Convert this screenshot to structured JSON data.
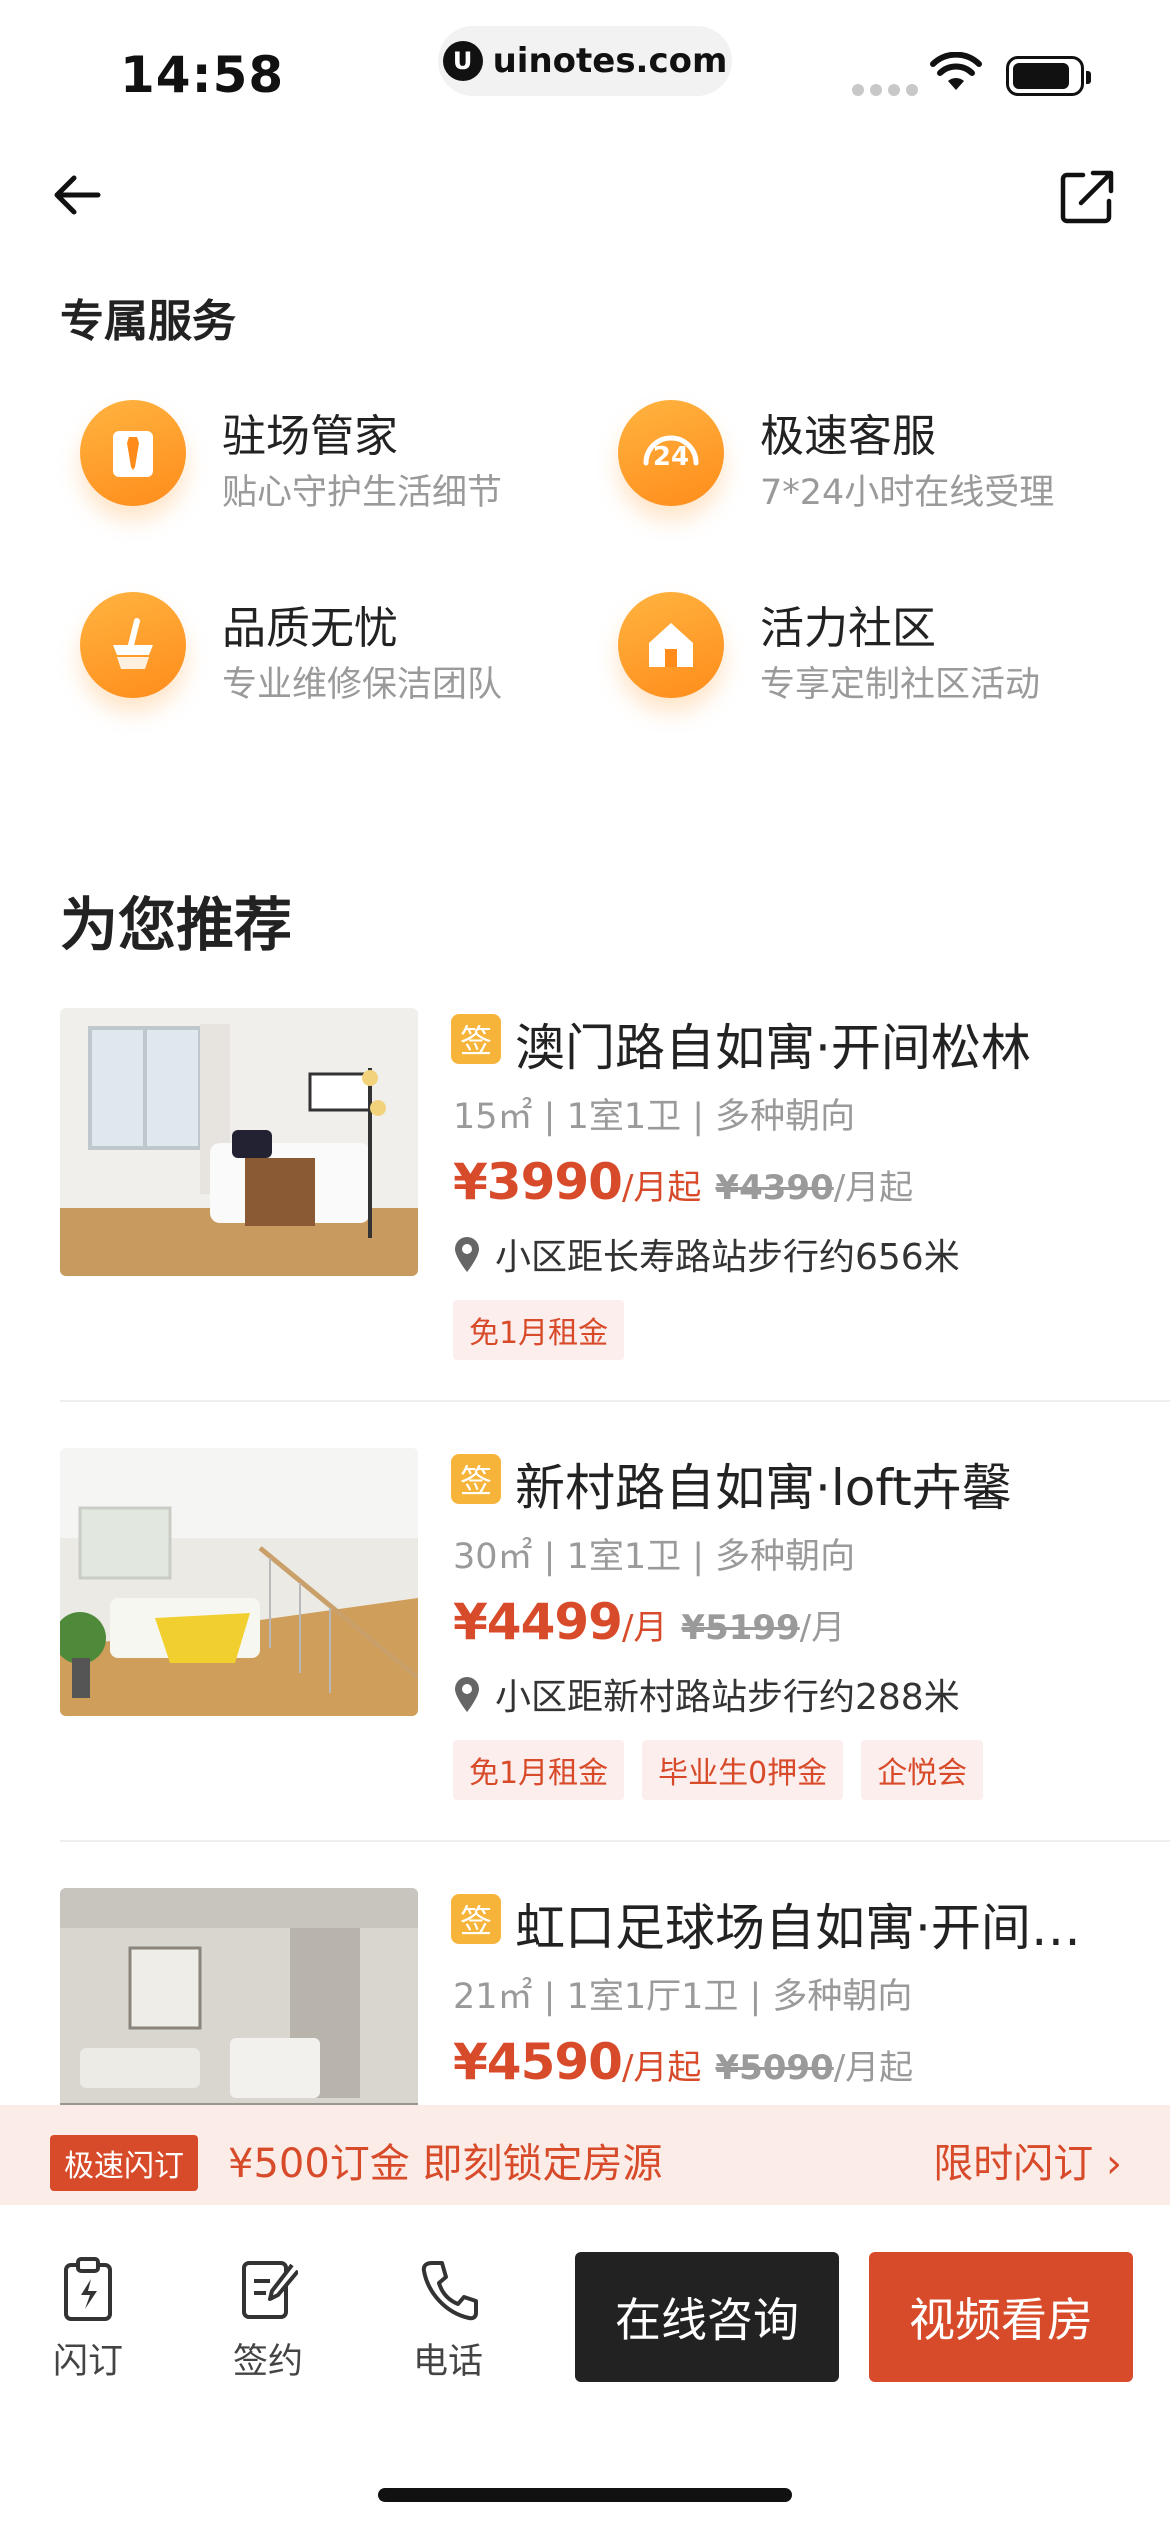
{
  "status": {
    "time": "14:58",
    "url": "uinotes.com",
    "url_logo": "U"
  },
  "services": {
    "title": "专属服务",
    "items": [
      {
        "title": "驻场管家",
        "subtitle": "贴心守护生活细节",
        "icon": "butler-icon"
      },
      {
        "title": "极速客服",
        "subtitle": "7*24小时在线受理",
        "icon": "24h-service-icon"
      },
      {
        "title": "品质无忧",
        "subtitle": "专业维修保洁团队",
        "icon": "broom-icon"
      },
      {
        "title": "活力社区",
        "subtitle": "专享定制社区活动",
        "icon": "house-icon"
      }
    ]
  },
  "recommend": {
    "title": "为您推荐",
    "sign_label": "签",
    "listings": [
      {
        "title": "澳门路自如寓·开间松林",
        "meta": "15㎡ | 1室1卫 | 多种朝向",
        "price": "¥3990",
        "unit": "/月起",
        "old_price": "¥4390",
        "old_unit": "/月起",
        "location": "小区距长寿路站步行约656米",
        "tags": [
          "免1月租金"
        ]
      },
      {
        "title": "新村路自如寓·loft卉馨",
        "meta": "30㎡ | 1室1卫 | 多种朝向",
        "price": "¥4499",
        "unit": "/月",
        "old_price": "¥5199",
        "old_unit": "/月",
        "location": "小区距新村路站步行约288米",
        "tags": [
          "免1月租金",
          "毕业生0押金",
          "企悦会"
        ]
      },
      {
        "title": "虹口足球场自如寓·开间…",
        "meta": "21㎡ | 1室1厅1卫 | 多种朝向",
        "price": "¥4590",
        "unit": "/月起",
        "old_price": "¥5090",
        "old_unit": "/月起",
        "location": "",
        "tags": []
      }
    ]
  },
  "promo": {
    "badge": "极速闪订",
    "message": "¥500订金 即刻锁定房源",
    "action": "限时闪订 ›"
  },
  "bottom": {
    "tools": [
      {
        "label": "闪订",
        "icon": "flash-order-icon"
      },
      {
        "label": "签约",
        "icon": "sign-contract-icon"
      },
      {
        "label": "电话",
        "icon": "phone-icon"
      }
    ],
    "consult": "在线咨询",
    "video": "视频看房"
  },
  "colors": {
    "accent": "#d84b2a",
    "orange": "#ff9a2a",
    "dark": "#222222"
  }
}
